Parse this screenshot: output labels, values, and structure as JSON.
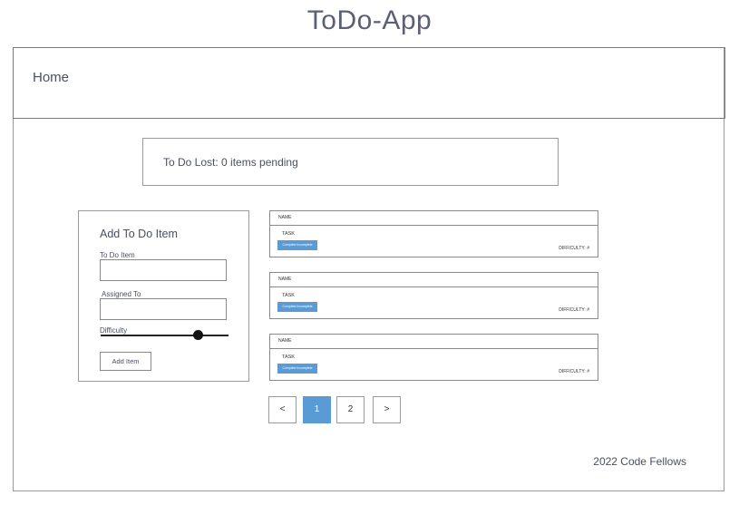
{
  "app_title": "ToDo-App",
  "nav": {
    "home_label": "Home"
  },
  "pending": {
    "text": "To Do Lost: 0 items pending"
  },
  "form": {
    "title": "Add To Do Item",
    "todo_label": "To Do Item",
    "todo_value": "",
    "assigned_label": "Assigned To",
    "assigned_value": "",
    "difficulty_label": "Difficulty",
    "difficulty_level": 0.76,
    "add_button_label": "Add Item"
  },
  "tasks": [
    {
      "name_label": "NAME",
      "task_label": "TASK",
      "status_label": "Complete Incomplete",
      "difficulty_label": "DIFFICULTY: #"
    },
    {
      "name_label": "NAME",
      "task_label": "TASK",
      "status_label": "Complete Incomplete",
      "difficulty_label": "DIFFICULTY: #"
    },
    {
      "name_label": "NAME",
      "task_label": "TASK",
      "status_label": "Complete Incomplete",
      "difficulty_label": "DIFFICULTY: #"
    }
  ],
  "pagination": {
    "prev_label": "<",
    "pages": [
      "1",
      "2"
    ],
    "active_page": "1",
    "next_label": ">"
  },
  "footer": {
    "text": "2022 Code Fellows"
  },
  "colors": {
    "accent": "#5b9bd5",
    "text": "#4a4f63",
    "border": "#9a9a9a"
  }
}
